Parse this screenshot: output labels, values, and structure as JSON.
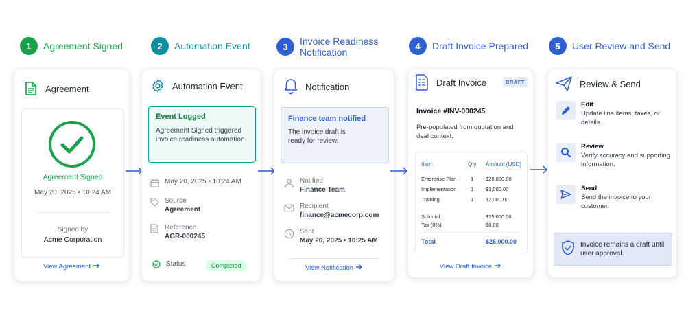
{
  "colors": {
    "green": "#16a34a",
    "teal": "#0e8fa0",
    "blue": "#2f5fd3",
    "link": "#2563eb"
  },
  "steps": [
    {
      "num": "1",
      "title": "Agreement Signed"
    },
    {
      "num": "2",
      "title": "Automation Event"
    },
    {
      "num": "3",
      "title": "Invoice Readiness Notification"
    },
    {
      "num": "4",
      "title": "Draft Invoice Prepared"
    },
    {
      "num": "5",
      "title": "User Review and Send"
    }
  ],
  "card1": {
    "title": "Agreement",
    "status": "Agreement Signed",
    "datetime": "May 20, 2025 • 10:24 AM",
    "signed_by_label": "Signed by",
    "signed_by": "Acme Corporation",
    "link": "View Agreement"
  },
  "card2": {
    "title": "Automation Event",
    "event_title": "Event Logged",
    "event_text": "Agreement Signed triggered invoice readiness automation.",
    "date": "May 20, 2025 • 10:24 AM",
    "source_label": "Source",
    "source": "Agreement",
    "reference_label": "Reference",
    "reference": "AGR-000245",
    "status_label": "Status",
    "status": "Completed"
  },
  "card3": {
    "title": "Notification",
    "box_title": "Finance team notified",
    "box_text": "The invoice draft is ready for review.",
    "notified_label": "Notified",
    "notified": "Finance Team",
    "recipient_label": "Recipient",
    "recipient": "finance@acmecorp.com",
    "sent_label": "Sent",
    "sent": "May 20, 2025 • 10:25 AM",
    "link": "View Notification"
  },
  "card4": {
    "title": "Draft Invoice",
    "badge": "DRAFT",
    "invoice_no": "Invoice #INV-000245",
    "desc": "Pre-populated from quotation and deal context.",
    "headers": {
      "item": "Item",
      "qty": "Qty",
      "amount": "Amount (USD)"
    },
    "rows": [
      {
        "item": "Enterprise Plan",
        "qty": "1",
        "amount": "$20,000.00"
      },
      {
        "item": "Implementation",
        "qty": "1",
        "amount": "$3,000.00"
      },
      {
        "item": "Training",
        "qty": "1",
        "amount": "$2,000.00"
      }
    ],
    "subtotal_label": "Subtotal",
    "subtotal": "$25,000.00",
    "tax_label": "Tax (0%)",
    "tax": "$0.00",
    "total_label": "Total",
    "total": "$25,000.00",
    "link": "View Draft Invoice"
  },
  "card5": {
    "title": "Review & Send",
    "actions": [
      {
        "title": "Edit",
        "text": "Update line items, taxes, or details.",
        "icon": "pencil-icon"
      },
      {
        "title": "Review",
        "text": "Verify accuracy and supporting information.",
        "icon": "magnifier-icon"
      },
      {
        "title": "Send",
        "text": "Send the invoice to your customer.",
        "icon": "send-icon"
      }
    ],
    "note": "Invoice remains a draft until user approval."
  }
}
